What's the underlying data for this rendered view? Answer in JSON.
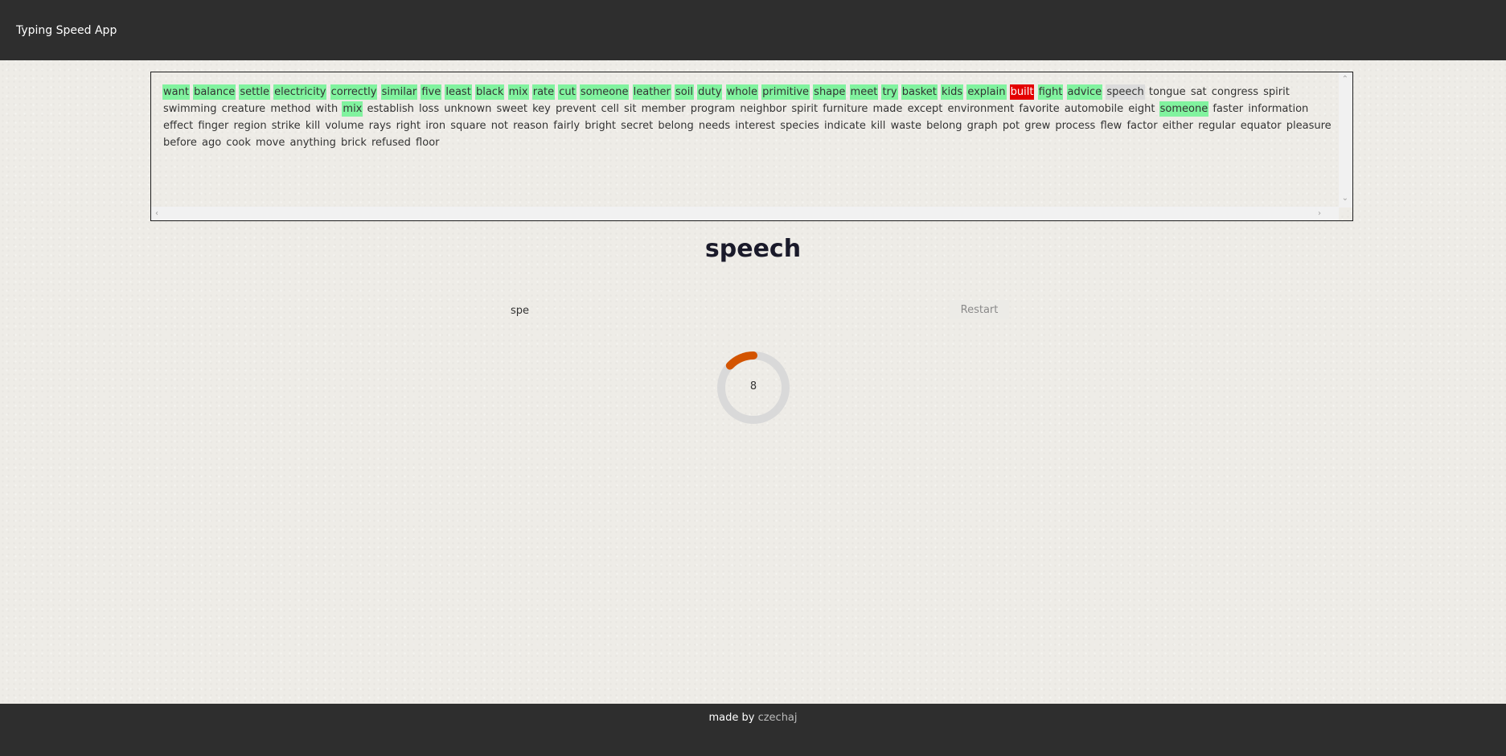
{
  "header": {
    "title": "Typing Speed App"
  },
  "text": {
    "words": [
      {
        "w": "want",
        "s": "correct"
      },
      {
        "w": "balance",
        "s": "correct"
      },
      {
        "w": "settle",
        "s": "correct"
      },
      {
        "w": "electricity",
        "s": "correct"
      },
      {
        "w": "correctly",
        "s": "correct"
      },
      {
        "w": "similar",
        "s": "correct"
      },
      {
        "w": "five",
        "s": "correct"
      },
      {
        "w": "least",
        "s": "correct"
      },
      {
        "w": "black",
        "s": "correct"
      },
      {
        "w": "mix",
        "s": "correct"
      },
      {
        "w": "rate",
        "s": "correct"
      },
      {
        "w": "cut",
        "s": "correct"
      },
      {
        "w": "someone",
        "s": "correct"
      },
      {
        "w": "leather",
        "s": "correct"
      },
      {
        "w": "soil",
        "s": "correct"
      },
      {
        "w": "duty",
        "s": "correct"
      },
      {
        "w": "whole",
        "s": "correct"
      },
      {
        "w": "primitive",
        "s": "correct"
      },
      {
        "w": "shape",
        "s": "correct"
      },
      {
        "w": "meet",
        "s": "correct"
      },
      {
        "w": "try",
        "s": "correct"
      },
      {
        "w": "basket",
        "s": "correct"
      },
      {
        "w": "kids",
        "s": "correct"
      },
      {
        "w": "explain",
        "s": "correct"
      },
      {
        "w": "built",
        "s": "wrong"
      },
      {
        "w": "fight",
        "s": "correct"
      },
      {
        "w": "advice",
        "s": "correct"
      },
      {
        "w": "speech",
        "s": "current"
      },
      {
        "w": "tongue",
        "s": ""
      },
      {
        "w": "sat",
        "s": ""
      },
      {
        "w": "congress",
        "s": ""
      },
      {
        "w": "spirit",
        "s": ""
      },
      {
        "w": "swimming",
        "s": ""
      },
      {
        "w": "creature",
        "s": ""
      },
      {
        "w": "method",
        "s": ""
      },
      {
        "w": "with",
        "s": ""
      },
      {
        "w": "mix",
        "s": "correct"
      },
      {
        "w": "establish",
        "s": ""
      },
      {
        "w": "loss",
        "s": ""
      },
      {
        "w": "unknown",
        "s": ""
      },
      {
        "w": "sweet",
        "s": ""
      },
      {
        "w": "key",
        "s": ""
      },
      {
        "w": "prevent",
        "s": ""
      },
      {
        "w": "cell",
        "s": ""
      },
      {
        "w": "sit",
        "s": ""
      },
      {
        "w": "member",
        "s": ""
      },
      {
        "w": "program",
        "s": ""
      },
      {
        "w": "neighbor",
        "s": ""
      },
      {
        "w": "spirit",
        "s": ""
      },
      {
        "w": "furniture",
        "s": ""
      },
      {
        "w": "made",
        "s": ""
      },
      {
        "w": "except",
        "s": ""
      },
      {
        "w": "environment",
        "s": ""
      },
      {
        "w": "favorite",
        "s": ""
      },
      {
        "w": "automobile",
        "s": ""
      },
      {
        "w": "eight",
        "s": ""
      },
      {
        "w": "someone",
        "s": "correct"
      },
      {
        "w": "faster",
        "s": ""
      },
      {
        "w": "information",
        "s": ""
      },
      {
        "w": "effect",
        "s": ""
      },
      {
        "w": "finger",
        "s": ""
      },
      {
        "w": "region",
        "s": ""
      },
      {
        "w": "strike",
        "s": ""
      },
      {
        "w": "kill",
        "s": ""
      },
      {
        "w": "volume",
        "s": ""
      },
      {
        "w": "rays",
        "s": ""
      },
      {
        "w": "right",
        "s": ""
      },
      {
        "w": "iron",
        "s": ""
      },
      {
        "w": "square",
        "s": ""
      },
      {
        "w": "not",
        "s": ""
      },
      {
        "w": "reason",
        "s": ""
      },
      {
        "w": "fairly",
        "s": ""
      },
      {
        "w": "bright",
        "s": ""
      },
      {
        "w": "secret",
        "s": ""
      },
      {
        "w": "belong",
        "s": ""
      },
      {
        "w": "needs",
        "s": ""
      },
      {
        "w": "interest",
        "s": ""
      },
      {
        "w": "species",
        "s": ""
      },
      {
        "w": "indicate",
        "s": ""
      },
      {
        "w": "kill",
        "s": ""
      },
      {
        "w": "waste",
        "s": ""
      },
      {
        "w": "belong",
        "s": ""
      },
      {
        "w": "graph",
        "s": ""
      },
      {
        "w": "pot",
        "s": ""
      },
      {
        "w": "grew",
        "s": ""
      },
      {
        "w": "process",
        "s": ""
      },
      {
        "w": "flew",
        "s": ""
      },
      {
        "w": "factor",
        "s": ""
      },
      {
        "w": "either",
        "s": ""
      },
      {
        "w": "regular",
        "s": ""
      },
      {
        "w": "equator",
        "s": ""
      },
      {
        "w": "pleasure",
        "s": ""
      },
      {
        "w": "before",
        "s": ""
      },
      {
        "w": "ago",
        "s": ""
      },
      {
        "w": "cook",
        "s": ""
      },
      {
        "w": "move",
        "s": ""
      },
      {
        "w": "anything",
        "s": ""
      },
      {
        "w": "brick",
        "s": ""
      },
      {
        "w": "refused",
        "s": ""
      },
      {
        "w": "floor",
        "s": ""
      }
    ]
  },
  "current_word": "speech",
  "input": {
    "value": "spe"
  },
  "restart_label": "Restart",
  "timer": {
    "value": "8",
    "progress": 0.13,
    "color": "#d35400",
    "track_color": "#d9d9d9"
  },
  "footer": {
    "prefix": "made by",
    "author": "czechaj"
  },
  "colors": {
    "correct": "#81f39f",
    "wrong": "#e40000",
    "current": "#dcdcdc",
    "bar": "#2e2e2e"
  },
  "icons": {
    "scroll_up": "chevron-up-icon",
    "scroll_down": "chevron-down-icon",
    "scroll_left": "chevron-left-icon",
    "scroll_right": "chevron-right-icon"
  }
}
